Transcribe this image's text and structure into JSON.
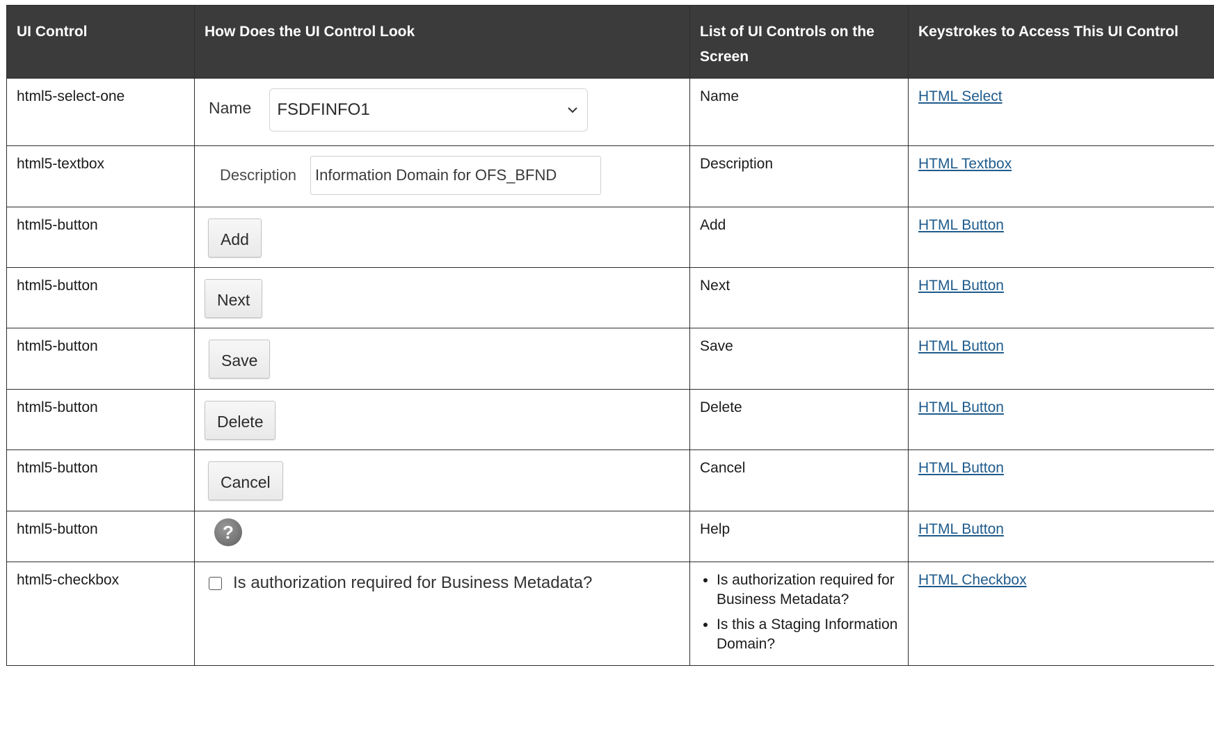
{
  "headers": [
    "UI Control",
    "How Does the UI Control Look",
    "List of UI Controls on the Screen",
    "Keystrokes to Access This UI Control"
  ],
  "rows": [
    {
      "control": "html5-select-one",
      "look_label": "Name",
      "look_value": "FSDFINFO1",
      "list": "Name",
      "keystroke": "HTML Select"
    },
    {
      "control": "html5-textbox",
      "look_label": "Description",
      "look_value": "Information Domain for OFS_BFND",
      "list": "Description",
      "keystroke": "HTML Textbox"
    },
    {
      "control": "html5-button",
      "look_label": "Add",
      "list": "Add",
      "keystroke": "HTML Button"
    },
    {
      "control": "html5-button",
      "look_label": "Next",
      "list": "Next",
      "keystroke": "HTML Button"
    },
    {
      "control": "html5-button",
      "look_label": "Save",
      "list": "Save",
      "keystroke": "HTML Button"
    },
    {
      "control": "html5-button",
      "look_label": "Delete",
      "list": "Delete",
      "keystroke": "HTML Button"
    },
    {
      "control": "html5-button",
      "look_label": "Cancel",
      "list": "Cancel",
      "keystroke": "HTML Button"
    },
    {
      "control": "html5-button",
      "look_icon": "help-icon",
      "list": "Help",
      "keystroke": "HTML Button"
    },
    {
      "control": "html5-checkbox",
      "look_label": "Is authorization required for Business Metadata?",
      "list_items": [
        "Is authorization required for Business Metadata?",
        "Is this a Staging Information Domain?"
      ],
      "keystroke": "HTML Checkbox"
    }
  ],
  "colors": {
    "header_bg": "#3b3b3b",
    "link": "#1f5b8c"
  }
}
